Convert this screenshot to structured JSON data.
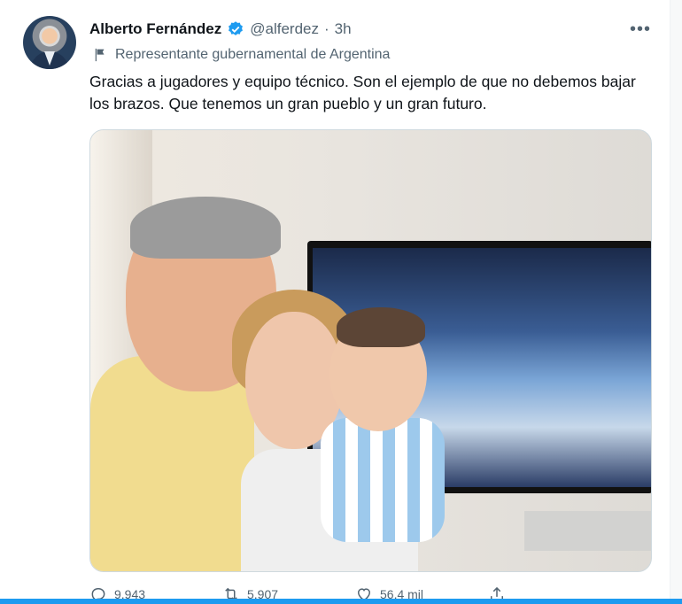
{
  "tweet": {
    "author_name": "Alberto Fernández",
    "handle": "@alferdez",
    "separator": "·",
    "time": "3h",
    "label": "Representante gubernamental de Argentina",
    "text": "Gracias a jugadores y equipo técnico. Son el ejemplo de que no debemos bajar los brazos. Que tenemos un gran pueblo y un gran futuro.",
    "more_glyph": "•••"
  },
  "actions": {
    "replies": "9.943",
    "retweets": "5.907",
    "likes": "56,4 mil"
  },
  "colors": {
    "accent": "#1d9bf0",
    "text_primary": "#0f1419",
    "text_secondary": "#536471"
  },
  "icons": [
    "verified-badge-icon",
    "government-flag-icon",
    "more-options-icon",
    "reply-icon",
    "retweet-icon",
    "like-icon",
    "share-icon"
  ]
}
